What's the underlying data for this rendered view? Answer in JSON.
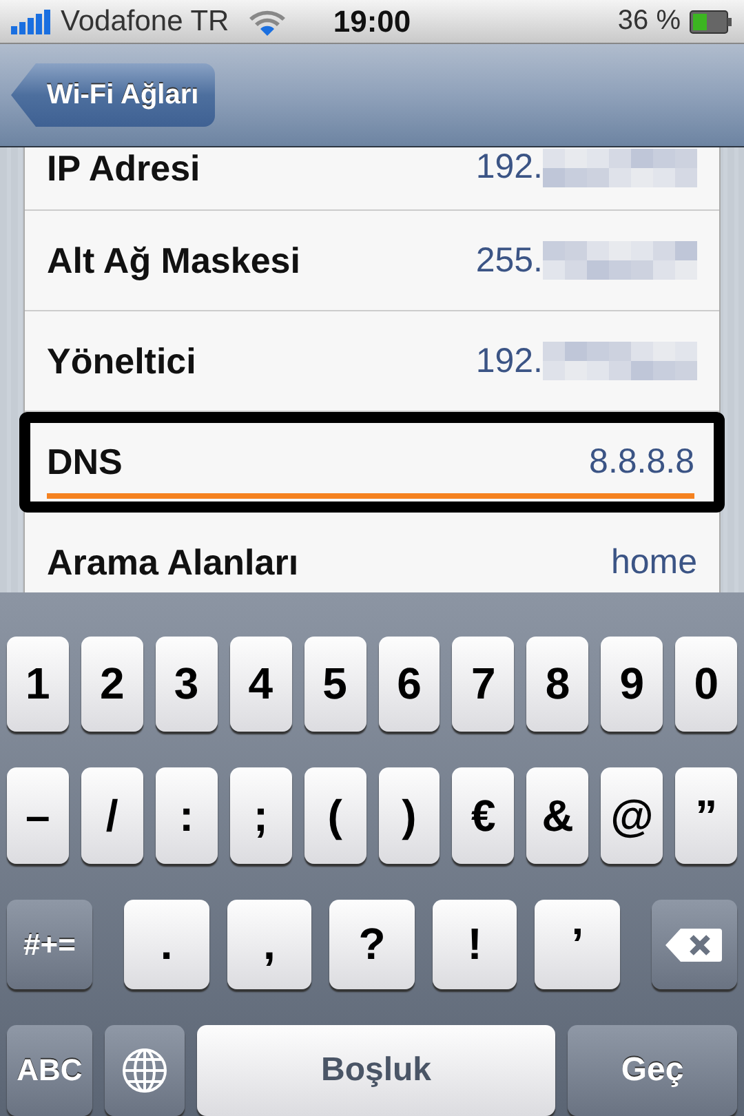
{
  "status_bar": {
    "carrier": "Vodafone TR",
    "time": "19:00",
    "battery": "36 %"
  },
  "nav_bar": {
    "back_button": "Wi-Fi Ağları"
  },
  "rows": [
    {
      "label": "IP Adresi",
      "value": "192.",
      "redacted": true,
      "editing": false
    },
    {
      "label": "Alt Ağ Maskesi",
      "value": "255.",
      "redacted": true,
      "editing": false
    },
    {
      "label": "Yöneltici",
      "value": "192.",
      "redacted": true,
      "editing": false
    },
    {
      "label": "DNS",
      "value": "8.8.8.8",
      "redacted": false,
      "editing": true
    },
    {
      "label": "Arama Alanları",
      "value": "home",
      "redacted": false,
      "editing": false
    }
  ],
  "keyboard": {
    "rows": [
      {
        "keys": [
          {
            "kind": "char",
            "label": "1"
          },
          {
            "kind": "char",
            "label": "2"
          },
          {
            "kind": "char",
            "label": "3"
          },
          {
            "kind": "char",
            "label": "4"
          },
          {
            "kind": "char",
            "label": "5"
          },
          {
            "kind": "char",
            "label": "6"
          },
          {
            "kind": "char",
            "label": "7"
          },
          {
            "kind": "char",
            "label": "8"
          },
          {
            "kind": "char",
            "label": "9"
          },
          {
            "kind": "char",
            "label": "0"
          }
        ]
      },
      {
        "keys": [
          {
            "kind": "char",
            "label": "–"
          },
          {
            "kind": "char",
            "label": "/"
          },
          {
            "kind": "char",
            "label": ":"
          },
          {
            "kind": "char",
            "label": ";"
          },
          {
            "kind": "char",
            "label": "("
          },
          {
            "kind": "char",
            "label": ")"
          },
          {
            "kind": "char",
            "label": "€"
          },
          {
            "kind": "char",
            "label": "&"
          },
          {
            "kind": "char",
            "label": "@"
          },
          {
            "kind": "char",
            "label": "”"
          }
        ]
      },
      {
        "keys": [
          {
            "kind": "function",
            "label": "#+="
          },
          {
            "kind": "char",
            "label": "."
          },
          {
            "kind": "char",
            "label": ","
          },
          {
            "kind": "char",
            "label": "?"
          },
          {
            "kind": "char",
            "label": "!"
          },
          {
            "kind": "char",
            "label": "’"
          },
          {
            "kind": "delete"
          }
        ]
      },
      {
        "keys": [
          {
            "kind": "function",
            "label": "ABC"
          },
          {
            "kind": "globe"
          },
          {
            "kind": "space",
            "label": "Boşluk"
          },
          {
            "kind": "action",
            "label": "Geç"
          }
        ]
      }
    ]
  }
}
